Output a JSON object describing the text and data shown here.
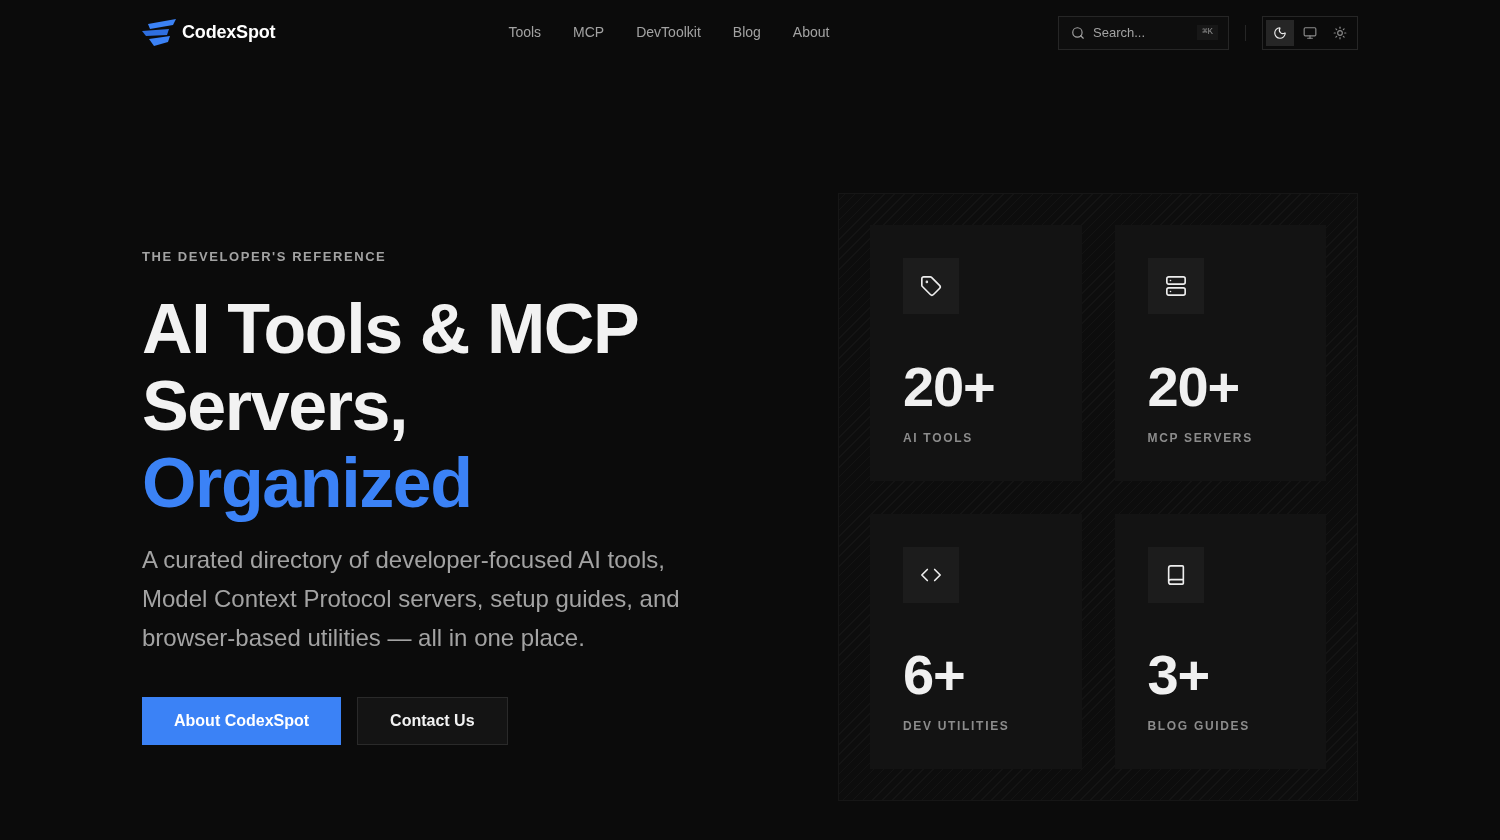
{
  "header": {
    "logo": "CodexSpot",
    "nav": [
      "Tools",
      "MCP",
      "DevToolkit",
      "Blog",
      "About"
    ],
    "search": {
      "placeholder": "Search...",
      "shortcut": "⌘K"
    },
    "theme_options": [
      {
        "kind": "dark",
        "selected": true
      },
      {
        "kind": "system",
        "selected": false
      },
      {
        "kind": "light",
        "selected": false
      }
    ]
  },
  "hero": {
    "eyebrow": "THE DEVELOPER'S REFERENCE",
    "title": "AI Tools & MCP Servers,",
    "title_highlight": "Organized",
    "description": "A curated directory of developer-focused AI tools, Model Context Protocol servers, setup guides, and browser-based utilities — all in one place.",
    "buttons": [
      {
        "label": "About CodexSpot",
        "kind": "primary"
      },
      {
        "label": "Contact Us",
        "kind": "secondary"
      }
    ]
  },
  "stats": [
    {
      "kind": "tag",
      "value": "20+",
      "label": "AI TOOLS"
    },
    {
      "kind": "server",
      "value": "20+",
      "label": "MCP SERVERS"
    },
    {
      "kind": "code",
      "value": "6+",
      "label": "DEV UTILITIES"
    },
    {
      "kind": "book",
      "value": "3+",
      "label": "BLOG GUIDES"
    }
  ]
}
